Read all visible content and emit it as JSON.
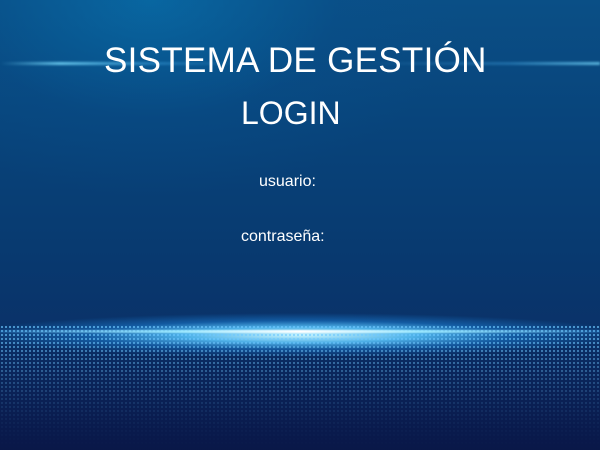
{
  "header": {
    "title": "SISTEMA DE GESTIÓN",
    "subtitle": "LOGIN"
  },
  "form": {
    "username_label": "usuario:",
    "password_label": "contraseña:"
  },
  "colors": {
    "background_top": "#0a4f86",
    "background_bottom": "#091f55",
    "text": "#ffffff",
    "glow": "#78dcff"
  }
}
